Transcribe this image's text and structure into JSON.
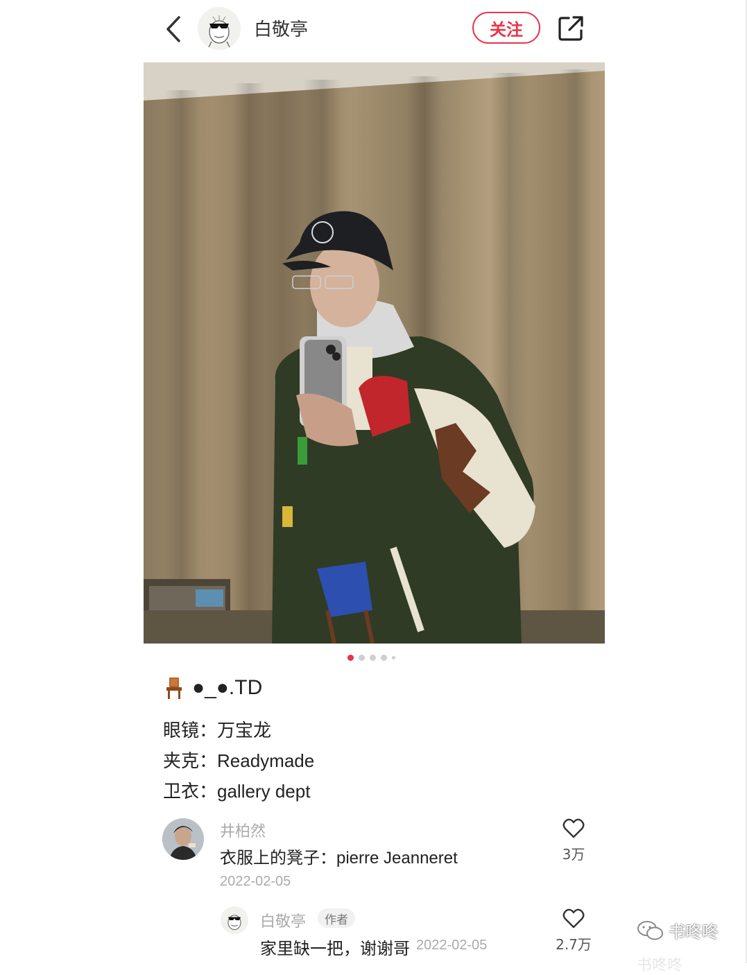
{
  "header": {
    "author_name": "白敬亭",
    "follow_label": "关注"
  },
  "icons": {
    "back": "chevron-left-icon",
    "share": "share-icon",
    "like": "heart-icon",
    "chair": "chair-emoji-icon",
    "wechat": "wechat-icon"
  },
  "carousel": {
    "total_dots": 5,
    "active_index": 0
  },
  "post": {
    "title": "●_●.TD",
    "lines": [
      "眼镜：万宝龙",
      "夹克：Readymade",
      "卫衣：gallery dept"
    ]
  },
  "comment": {
    "name": "井柏然",
    "text": "衣服上的凳子：pierre Jeanneret",
    "date": "2022-02-05",
    "likes": "3万"
  },
  "reply": {
    "name": "白敬亭",
    "badge": "作者",
    "text": "家里缺一把，谢谢哥",
    "date": "2022-02-05",
    "likes": "2.7万"
  },
  "watermark": {
    "text": "书咚咚",
    "text2": "书咚咚"
  },
  "colors": {
    "accent": "#e8334a"
  }
}
